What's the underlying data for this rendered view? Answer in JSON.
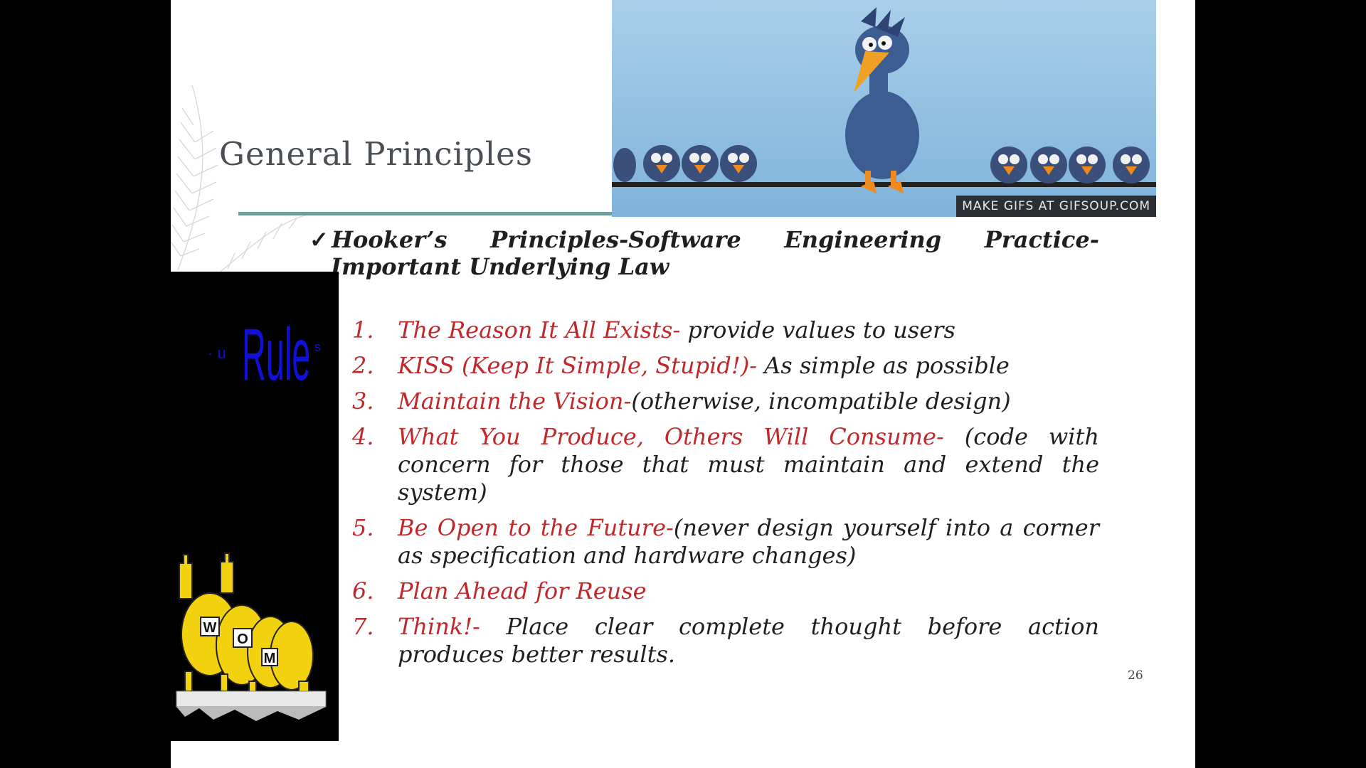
{
  "slide": {
    "title": "General Principles",
    "gif_caption": "MAKE GIFS AT GIFSOUP.COM",
    "subtitle_words": [
      "Hooker’s",
      "Principles-Software",
      "Engineering",
      "Practice-"
    ],
    "subtitle_line2": "Important Underlying Law",
    "animation_text": "Rule",
    "animation_dots_left": "· u",
    "animation_dots_right": "s",
    "smiley_letters": [
      "W",
      "O",
      "M"
    ],
    "page_number": "26",
    "colors": {
      "accent_red": "#c0282b",
      "rule_teal": "#6e9e98",
      "anim_blue": "#1010d8"
    }
  },
  "principles": [
    {
      "num": "1.",
      "title": "The Reason It All Exists-",
      "desc": " provide values to users"
    },
    {
      "num": "2.",
      "title": "KISS (Keep It Simple, Stupid!)-",
      "desc": " As simple as possible"
    },
    {
      "num": "3.",
      "title": "Maintain the Vision-",
      "desc": "(otherwise, incompatible design)"
    },
    {
      "num": "4.",
      "title": "What You Produce, Others Will Consume-",
      "desc": " (code with concern for those that must maintain and extend the system)"
    },
    {
      "num": "5.",
      "title": "Be Open to the Future-",
      "desc": "(never design yourself into a corner as specification and hardware changes)"
    },
    {
      "num": "6.",
      "title": "Plan Ahead for Reuse",
      "desc": ""
    },
    {
      "num": "7.",
      "title": "Think!-",
      "desc": " Place clear complete thought before action produces better results."
    }
  ]
}
